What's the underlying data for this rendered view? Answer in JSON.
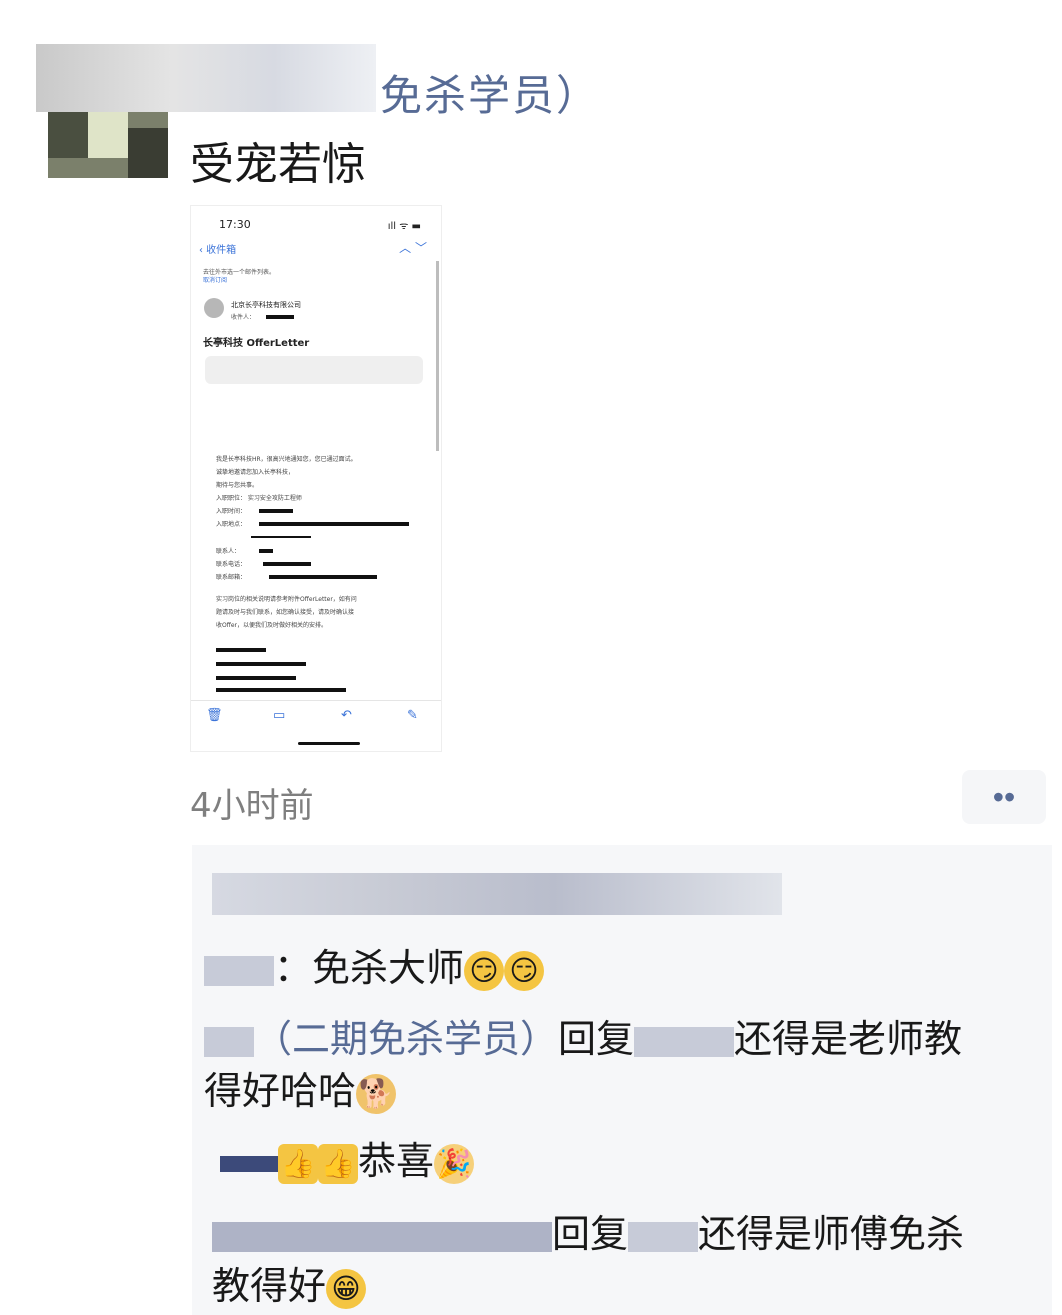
{
  "post": {
    "username": "免杀学员）",
    "text": "受宠若惊",
    "time_ago": "4小时前",
    "more_icon": "••"
  },
  "screenshot": {
    "status_time": "17:30",
    "status_icons": "ıll ᯤ ▬",
    "back_label": "‹ 收件箱",
    "nav_arrows": "︿ ﹀",
    "notice_line1": "去往外市选一个邮件列表。",
    "notice_line2": "取消订阅",
    "sender": "北京长亭科技有限公司",
    "recipient_label": "收件人：",
    "subject": "长亭科技 OfferLetter",
    "body_lines": [
      "我是长亭科技HR，很高兴地通知您，您已通过面试。",
      "诚挚地邀请您加入长亭科技，",
      "期待与您共事。",
      "入职职位：  实习安全攻防工程师",
      "入职时间：",
      "入职地点：",
      "联系人：",
      "联系电话：",
      "联系邮箱：",
      "实习岗位的相关说明请参考附件OfferLetter，如有问",
      "题请及时与我们联系，如您确认接受，请及时确认接",
      "收Offer，以便我们及时做好相关的安排。"
    ],
    "toolbar_icons": [
      "trash-icon",
      "folder-icon",
      "reply-icon",
      "compose-icon"
    ]
  },
  "comments": [
    {
      "text": "：免杀大师"
    },
    {
      "name": "（二期免杀学员）",
      "reply_label": "回复",
      "text": "还得是老师教",
      "text2": "得好哈哈"
    },
    {
      "text": "恭喜"
    },
    {
      "reply_label": "回复",
      "text": "还得是师傅免杀",
      "text2": "教得好"
    }
  ],
  "colors": {
    "link": "#576b95",
    "timestamp": "#7f7f7f",
    "comment_bg": "#f6f7f9"
  }
}
